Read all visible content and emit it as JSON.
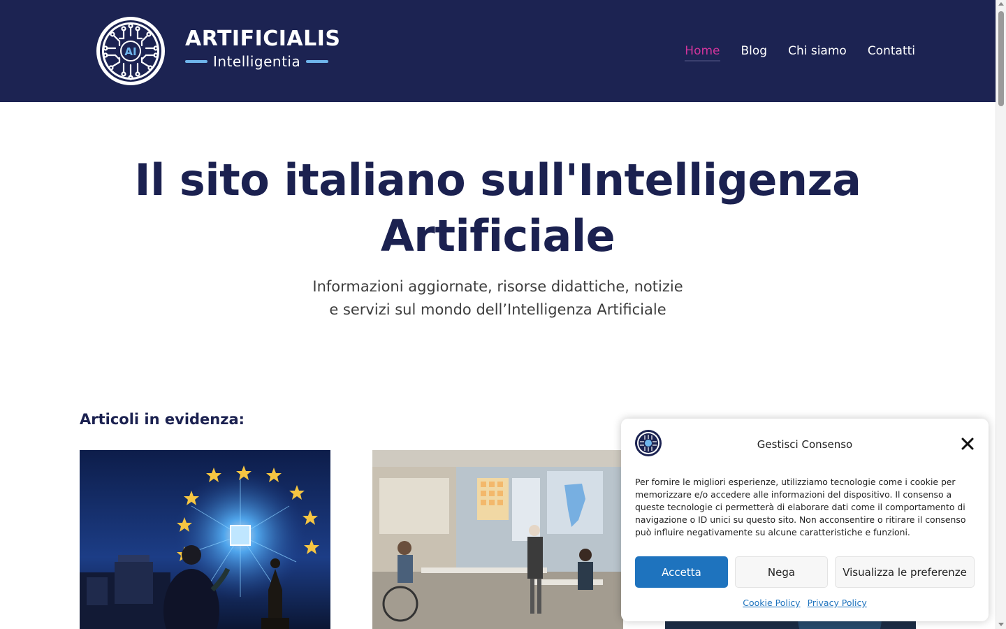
{
  "header": {
    "logo_title": "ARTIFICIALIS",
    "logo_subtitle": "Intelligentia",
    "logo_mark_text": "AI",
    "nav": [
      {
        "label": "Home",
        "active": true
      },
      {
        "label": "Blog",
        "active": false
      },
      {
        "label": "Chi siamo",
        "active": false
      },
      {
        "label": "Contatti",
        "active": false
      }
    ]
  },
  "hero": {
    "title_line1": "Il sito italiano sull'Intelligenza",
    "title_line2": "Artificiale",
    "subtitle_line1": "Informazioni aggiornate, risorse didattiche, notizie",
    "subtitle_line2": "e servizi sul mondo dell’Intelligenza Artificiale"
  },
  "featured": {
    "title": "Articoli in evidenza:"
  },
  "cookie_banner": {
    "title": "Gestisci Consenso",
    "text": "Per fornire le migliori esperienze, utilizziamo tecnologie come i cookie per memorizzare e/o accedere alle informazioni del dispositivo. Il consenso a queste tecnologie ci permetterà di elaborare dati come il comportamento di navigazione o ID unici su questo sito. Non acconsentire o ritirare il consenso può influire negativamente su alcune caratteristiche e funzioni.",
    "accept_label": "Accetta",
    "deny_label": "Nega",
    "prefs_label": "Visualizza le preferenze",
    "cookie_policy_label": "Cookie Policy",
    "privacy_policy_label": "Privacy Policy"
  },
  "colors": {
    "header_bg": "#1c2352",
    "accent": "#d1349b",
    "logo_blue": "#6fb5ec",
    "primary_button": "#1e73be",
    "heading": "#1b2150"
  }
}
